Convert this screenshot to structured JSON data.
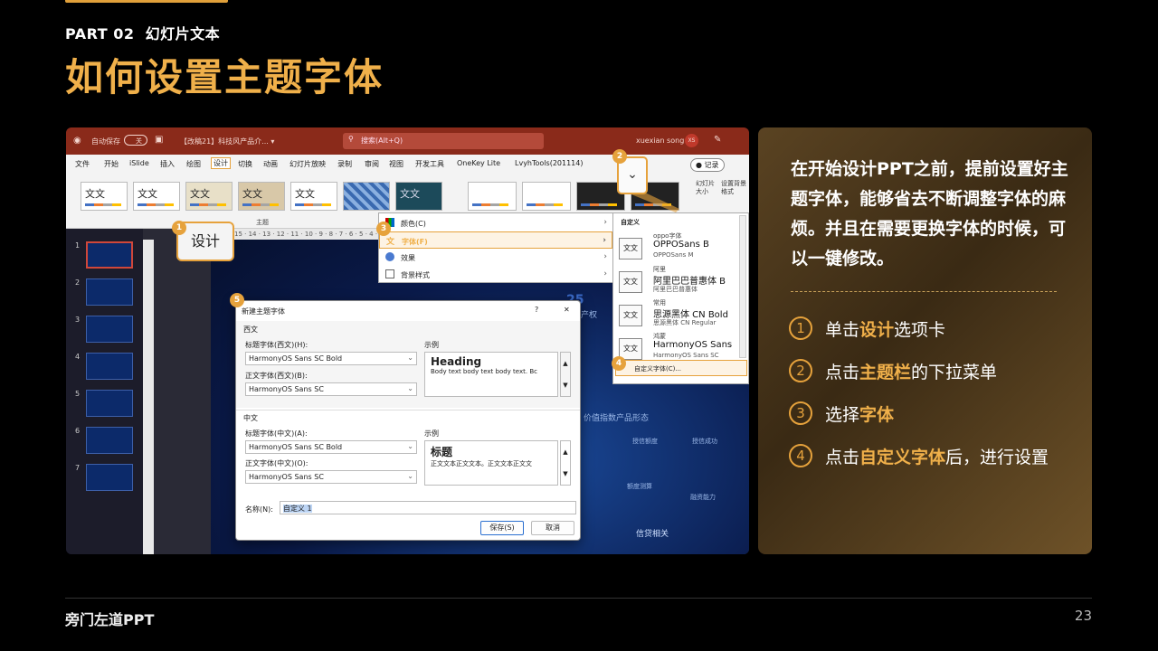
{
  "header": {
    "part_label": "PART 02",
    "section_label": "幻灯片文本",
    "title": "如何设置主题字体"
  },
  "screenshot": {
    "titlebar": {
      "autosave_label": "自动保存",
      "autosave_state": "关",
      "doc_title": "【改稿21】科技风产品介... ▾",
      "search_placeholder": "搜索(Alt+Q)",
      "user_name": "xuexian song",
      "user_initials": "XS"
    },
    "menu_items": [
      "文件",
      "开始",
      "iSlide",
      "插入",
      "绘图",
      "设计",
      "切换",
      "动画",
      "幻灯片放映",
      "录制",
      "审阅",
      "视图",
      "开发工具",
      "OneKey Lite",
      "LvyhTools(201114)"
    ],
    "record_label": "● 记录",
    "ribbon": {
      "theme_sample": "文文",
      "group_label": "主题",
      "slide_size_label": "幻灯片大小",
      "format_bg_label": "设置背景格式"
    },
    "ruler_text": "15 · 14 · 13 · 12 · 11 · 10 · 9 · 8 · 7 · 6 · 5 · 4 · 3 · 2 · 1 · 0 · 1 · 2 · 3 · 4 · 5 · 6 · 7 · 8 · 9 · 10 · 11",
    "slide_numbers": [
      "1",
      "2",
      "3",
      "4",
      "5",
      "6",
      "7"
    ],
    "design_tab_zoom": "设计",
    "dropdown_zoom": "⌄",
    "callouts": [
      "1",
      "2",
      "3",
      "4",
      "5"
    ],
    "context_menu": [
      {
        "label": "颜色(C)"
      },
      {
        "label": "字体(F)"
      },
      {
        "label": "效果"
      },
      {
        "label": "背景样式"
      }
    ],
    "font_pane": {
      "header": "自定义",
      "items": [
        {
          "icon": "文文",
          "category": "oppo字体",
          "name": "OPPOSans B",
          "sub": "OPPOSans M"
        },
        {
          "icon": "文文",
          "category": "阿里",
          "name": "阿里巴巴普惠体 B",
          "sub": "阿里巴巴普惠体"
        },
        {
          "icon": "文文",
          "category": "常用",
          "name": "思源黑体 CN Bold",
          "sub": "思源黑体 CN Regular"
        },
        {
          "icon": "文文",
          "category": "鸿蒙",
          "name": "HarmonyOS Sans",
          "sub": "HarmonyOS Sans SC"
        }
      ],
      "custom_label": "自定义字体(C)..."
    },
    "slide_texts": {
      "year": "25",
      "side_label": "知识产权",
      "mid_label": "价值指数产品形态",
      "bottom_label": "信贷相关",
      "node1": "授信额度",
      "node2": "授信成功",
      "node3": "额度测算",
      "node4": "融资能力"
    },
    "dialog": {
      "title": "新建主题字体",
      "help": "?",
      "close": "✕",
      "western_section": "西文",
      "heading_font_label_w": "标题字体(西文)(H):",
      "heading_font_value_w": "HarmonyOS Sans SC Bold",
      "body_font_label_w": "正文字体(西文)(B):",
      "body_font_value_w": "HarmonyOS Sans SC",
      "sample_label_w": "示例",
      "sample_heading_w": "Heading",
      "sample_body_w": "Body text body text body text. Bc",
      "chinese_section": "中文",
      "heading_font_label_c": "标题字体(中文)(A):",
      "heading_font_value_c": "HarmonyOS Sans SC Bold",
      "body_font_label_c": "正文字体(中文)(O):",
      "body_font_value_c": "HarmonyOS Sans SC",
      "sample_label_c": "示例",
      "sample_heading_c": "标题",
      "sample_body_c": "正文文本正文文本。正文文本正文文",
      "name_label": "名称(N):",
      "name_value": "自定义 1",
      "save_button": "保存(S)",
      "cancel_button": "取消"
    }
  },
  "panel": {
    "intro": "在开始设计PPT之前，提前设置好主题字体，能够省去不断调整字体的麻烦。并且在需要更换字体的时候，可以一键修改。",
    "steps": [
      {
        "num": "1",
        "pre": "单击",
        "hl": "设计",
        "post": "选项卡"
      },
      {
        "num": "2",
        "pre": "点击",
        "hl": "主题栏",
        "post": "的下拉菜单"
      },
      {
        "num": "3",
        "pre": "选择",
        "hl": "字体",
        "post": ""
      },
      {
        "num": "4",
        "pre": "点击",
        "hl": "自定义字体",
        "post": "后，进行设置"
      }
    ]
  },
  "footer": {
    "logo": "旁门左道PPT",
    "page_number": "23"
  },
  "colors": {
    "accent": "#f0b04a",
    "titlebar": "#8a2a1a",
    "panel_bg": "#4a3519"
  }
}
